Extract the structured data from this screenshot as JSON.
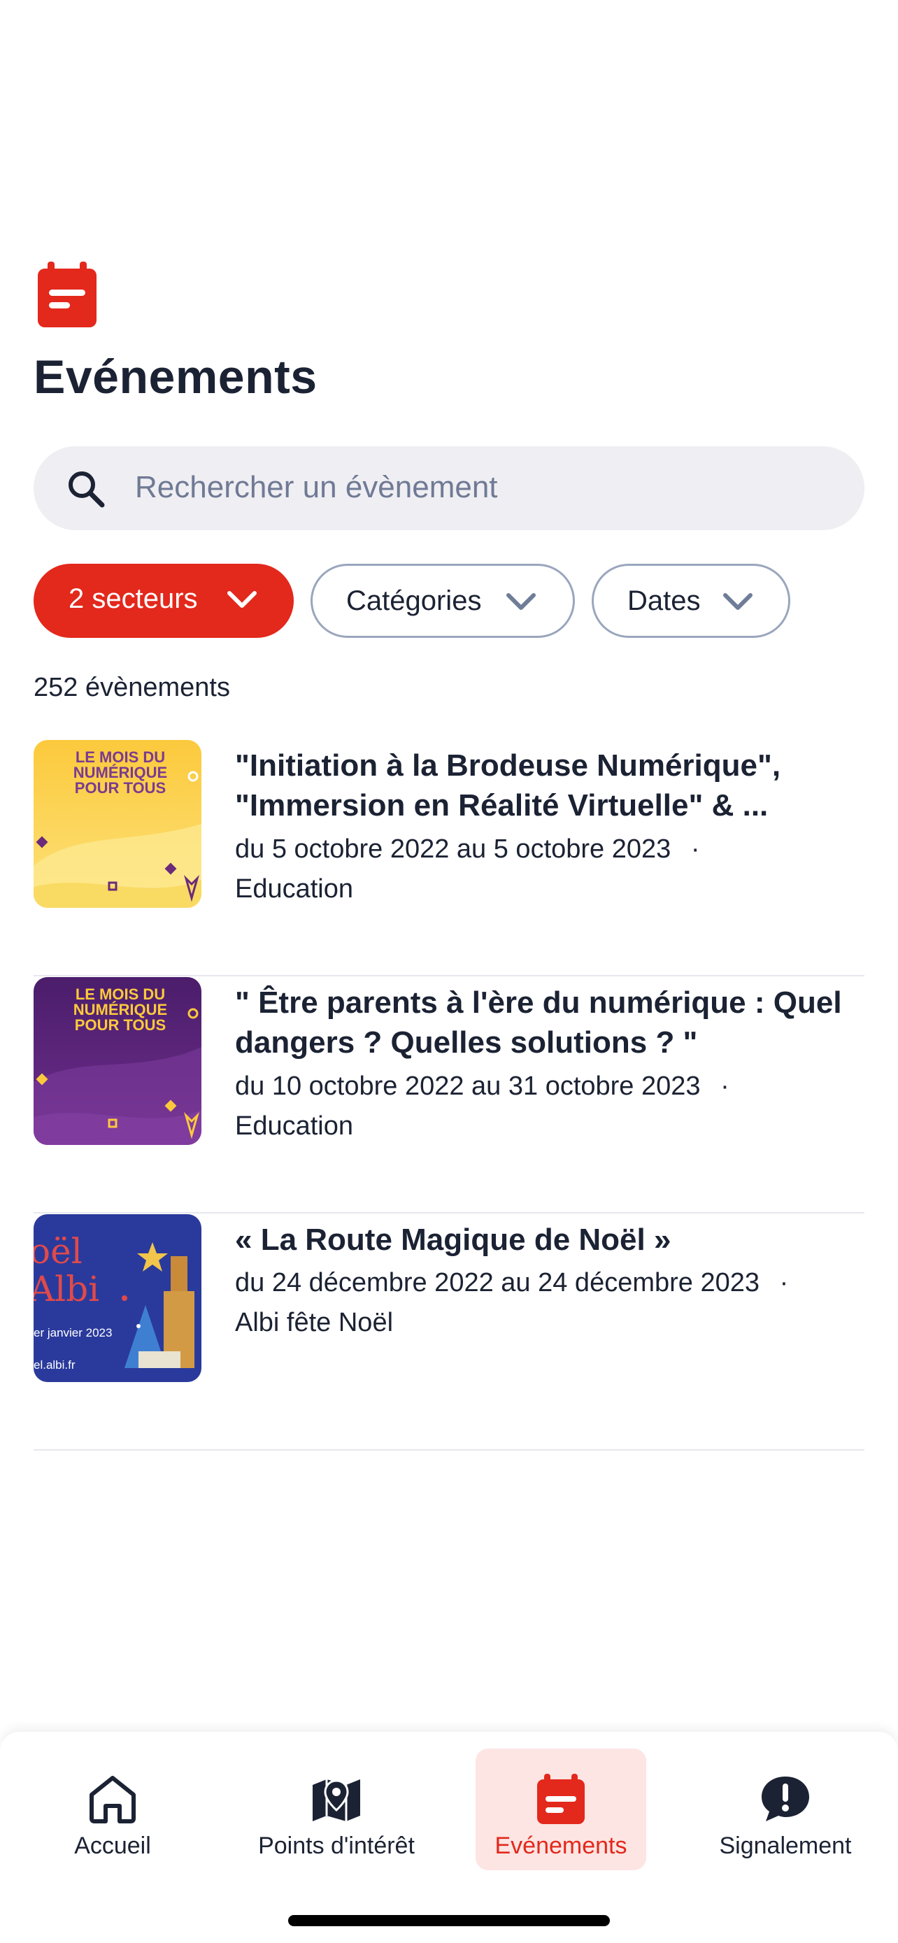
{
  "header": {
    "icon": "calendar-icon",
    "title": "Evénements"
  },
  "search": {
    "placeholder": "Rechercher un évènement",
    "icon": "search-icon"
  },
  "filters": {
    "sectors_label": "2 secteurs",
    "categories_label": "Catégories",
    "dates_label": "Dates"
  },
  "results_count": "252 évènements",
  "events": [
    {
      "title": "\"Initiation à la Brodeuse Numérique\", \"Immersion en Réalité Virtuelle\" & ...",
      "dates": "du 5 octobre 2022 au 5 octobre 2023",
      "separator": "·",
      "category": "Education",
      "thumb_text": "LE MOIS DU NUMÉRIQUE POUR TOUS"
    },
    {
      "title": "\" Être parents à l'ère du numérique : Quel dangers ? Quelles solutions ? \"",
      "dates": "du 10 octobre 2022 au 31 octobre 2023",
      "separator": "·",
      "category": "Education",
      "thumb_text": "LE MOIS DU NUMÉRIQUE POUR TOUS"
    },
    {
      "title": "« La Route Magique de Noël »",
      "dates": "du 24 décembre 2022 au 24 décembre 2023",
      "separator": "·",
      "category": "Albi fête Noël",
      "thumb_title_1": "oël",
      "thumb_title_2": "Albi",
      "thumb_date": "er janvier 2023",
      "thumb_url": "el.albi.fr"
    }
  ],
  "tabbar": [
    {
      "label": "Accueil",
      "icon": "home-icon",
      "active": false
    },
    {
      "label": "Points d'intérêt",
      "icon": "map-icon",
      "active": false
    },
    {
      "label": "Evénements",
      "icon": "calendar-icon",
      "active": true
    },
    {
      "label": "Signalement",
      "icon": "alert-bubble-icon",
      "active": false
    }
  ],
  "colors": {
    "accent": "#e3281c",
    "accent_light": "#fde5e3",
    "text": "#1b2233",
    "search_bg": "#efeef2",
    "chip_border": "#9aa6bd"
  }
}
